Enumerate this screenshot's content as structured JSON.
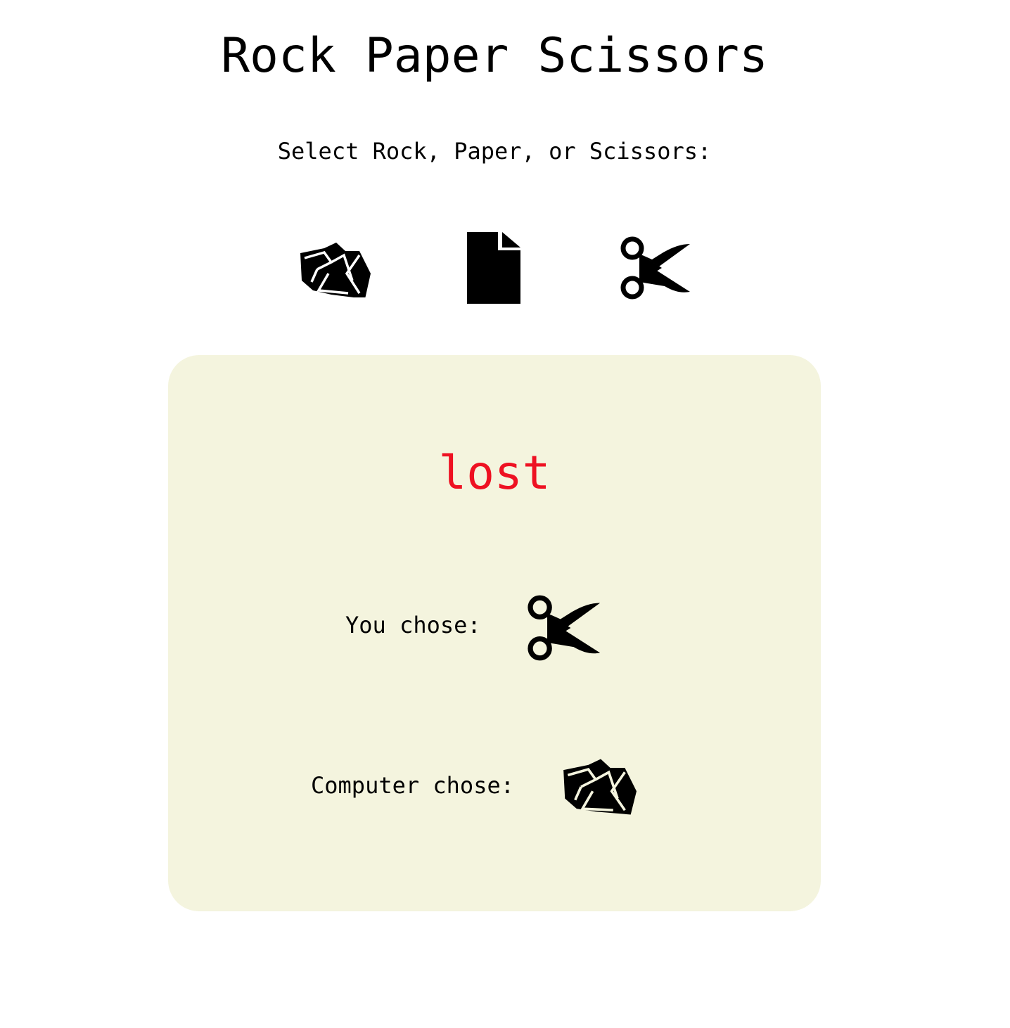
{
  "page": {
    "title": "Rock Paper Scissors",
    "prompt": "Select Rock, Paper, or Scissors:"
  },
  "choices": [
    {
      "label": "Rock",
      "icon": "rock-icon"
    },
    {
      "label": "Paper",
      "icon": "paper-icon"
    },
    {
      "label": "Scissors",
      "icon": "scissors-icon"
    }
  ],
  "result": {
    "outcome": "lost",
    "you_label": "You chose:",
    "you_choice_icon": "scissors-icon",
    "computer_label": "Computer chose:",
    "computer_choice_icon": "rock-icon"
  },
  "colors": {
    "panel_background": "#f4f4de",
    "outcome_color": "#ee1122",
    "text": "#000000"
  }
}
